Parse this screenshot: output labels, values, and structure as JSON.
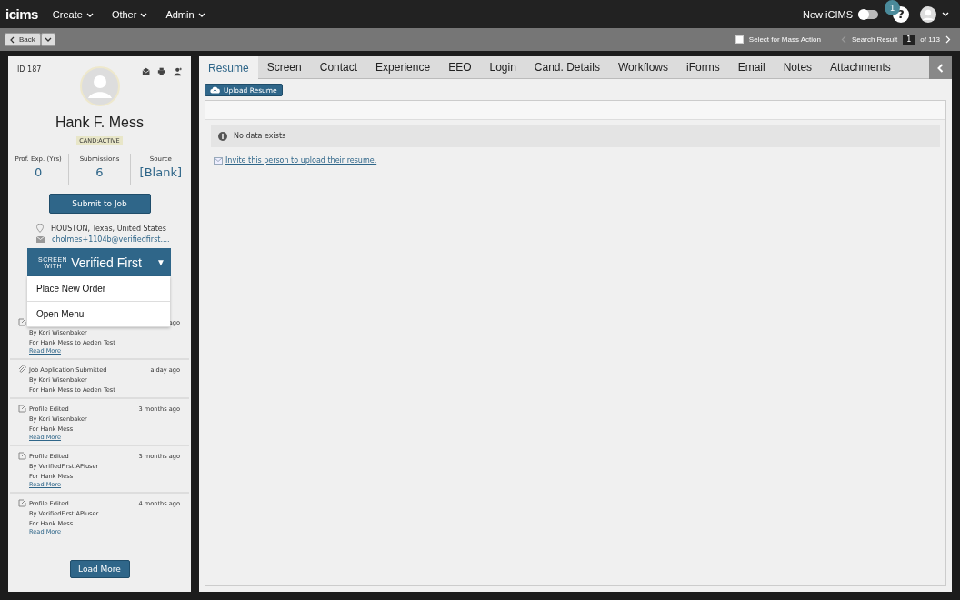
{
  "topbar": {
    "logo": "icims",
    "menus": [
      "Create",
      "Other",
      "Admin"
    ],
    "new_label": "New iCIMS",
    "new_on": false,
    "notification_count": "1",
    "help": "?"
  },
  "toolbar": {
    "back": "Back",
    "mass_action": {
      "label": "Select for Mass Action",
      "checked": false
    },
    "search_result_label": "Search Result",
    "page": "1",
    "of": "of 113"
  },
  "profile": {
    "id": "ID 187",
    "name": "Hank F. Mess",
    "status": "CAND:ACTIVE",
    "stats": [
      {
        "label": "Prof. Exp. (Yrs)",
        "value": "0"
      },
      {
        "label": "Submissions",
        "value": "6"
      },
      {
        "label": "Source",
        "value": "[Blank]"
      }
    ],
    "submit_button": "Submit to Job",
    "location": "HOUSTON, Texas, United States",
    "email": "cholmes+1104b@verifiedfirst...."
  },
  "screen_button": {
    "small_top": "SCREEN",
    "small_bottom": "WITH",
    "brand": "Verified First",
    "caret": "▼",
    "expanded": true,
    "menu": [
      "Place New Order",
      "Open Menu"
    ]
  },
  "activity": [
    {
      "kind": "edit",
      "time": "ago",
      "lines": [
        "By Kori Wisenbaker",
        "For Hank Mess to Aeden Test"
      ],
      "link": "Read More"
    },
    {
      "kind": "attach",
      "title": "Job Application Submitted",
      "time": "a day ago",
      "lines": [
        "By Kori Wisenbaker",
        "For Hank Mess to Aeden Test"
      ]
    },
    {
      "kind": "edit",
      "title": "Profile Edited",
      "time": "3 months ago",
      "lines": [
        "By Kori Wisenbaker",
        "For Hank Mess"
      ],
      "link": "Read More"
    },
    {
      "kind": "edit",
      "title": "Profile Edited",
      "time": "3 months ago",
      "lines": [
        "By VerifiedFirst APIuser",
        "For Hank Mess"
      ],
      "link": "Read More"
    },
    {
      "kind": "edit",
      "title": "Profile Edited",
      "time": "4 months ago",
      "lines": [
        "By VerifiedFirst APIuser",
        "For Hank Mess"
      ],
      "link": "Read More"
    }
  ],
  "load_more": "Load More",
  "tabs": [
    {
      "label": "Resume",
      "selected": true
    },
    {
      "label": "Screen",
      "selected": false
    },
    {
      "label": "Contact",
      "selected": false
    },
    {
      "label": "Experience",
      "selected": false
    },
    {
      "label": "EEO",
      "selected": false
    },
    {
      "label": "Login",
      "selected": false
    },
    {
      "label": "Cand. Details",
      "selected": false
    },
    {
      "label": "Workflows",
      "selected": false
    },
    {
      "label": "iForms",
      "selected": false
    },
    {
      "label": "Email",
      "selected": false
    },
    {
      "label": "Notes",
      "selected": false
    },
    {
      "label": "Attachments",
      "selected": false
    }
  ],
  "upload_button": "Upload Resume",
  "empty_message": "No data exists",
  "invite_link": "Invite this person to upload their resume."
}
